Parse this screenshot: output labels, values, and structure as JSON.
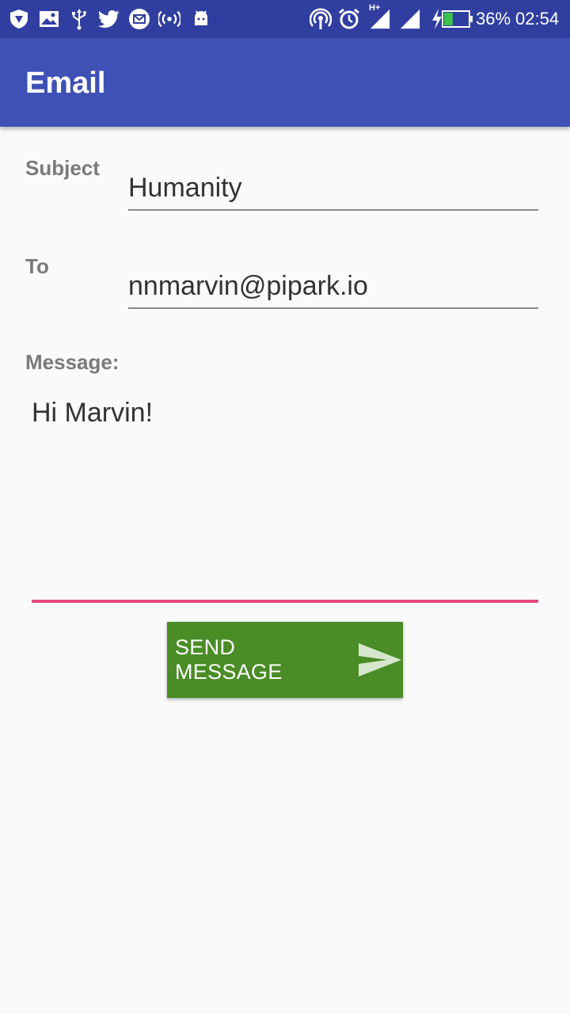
{
  "status_bar": {
    "battery_percent": "36%",
    "time": "02:54",
    "network_label": "H+",
    "battery_level": 0.36,
    "left_icons": [
      "vpn-shield-icon",
      "image-icon",
      "usb-icon",
      "twitter-icon",
      "email-notification-icon",
      "hotspot-icon",
      "android-icon"
    ],
    "right_icons": [
      "wireless-tether-icon",
      "alarm-icon",
      "signal-icon",
      "signal-icon",
      "charging-icon",
      "battery-icon"
    ]
  },
  "app_bar": {
    "title": "Email"
  },
  "form": {
    "subject_label": "Subject",
    "subject_value": "Humanity",
    "to_label": "To",
    "to_value": "nnmarvin@pipark.io",
    "message_label": "Message:",
    "message_value": "Hi Marvin!"
  },
  "send_button": {
    "label": "SEND MESSAGE",
    "icon": "send-icon"
  },
  "colors": {
    "status_bar": "#303f9f",
    "app_bar": "#3f51b5",
    "focus_accent": "#e84a7f",
    "send_button": "#4a8c25"
  }
}
